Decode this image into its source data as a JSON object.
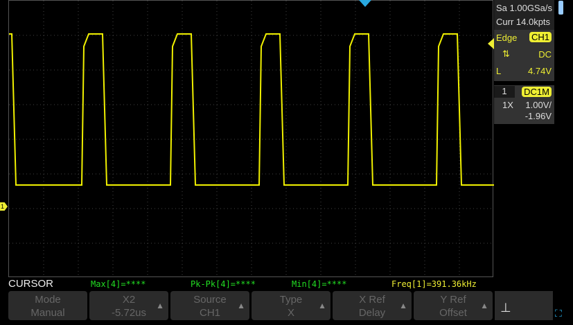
{
  "acquisition": {
    "sample_rate": "Sa 1.00GSa/s",
    "memory": "Curr 14.0kpts"
  },
  "trigger": {
    "type": "Edge",
    "source": "CH1",
    "slope_icon": "rise-fall-icon",
    "coupling": "DC",
    "level_label": "L",
    "level": "4.74V"
  },
  "channel": {
    "number": "1",
    "coupling": "DC1M",
    "probe": "1X",
    "scale": "1.00V/",
    "offset": "-1.96V",
    "marker": "1"
  },
  "status": {
    "mode": "CURSOR",
    "max": "Max[4]=****",
    "pkpk": "Pk-Pk[4]=****",
    "min": "Min[4]=****",
    "freq": "Freq[1]=391.36kHz"
  },
  "menu": [
    {
      "title": "Mode",
      "value": "Manual",
      "arrow": false
    },
    {
      "title": "X2",
      "value": "-5.72us",
      "arrow": true
    },
    {
      "title": "Source",
      "value": "CH1",
      "arrow": true
    },
    {
      "title": "Type",
      "value": "X",
      "arrow": true
    },
    {
      "title": "X Ref",
      "value": "Delay",
      "arrow": true
    },
    {
      "title": "Y Ref",
      "value": "Offset",
      "arrow": true
    }
  ],
  "colors": {
    "trace": "#f0f000",
    "measure": "#22dd22",
    "freq": "#eeee22"
  }
}
